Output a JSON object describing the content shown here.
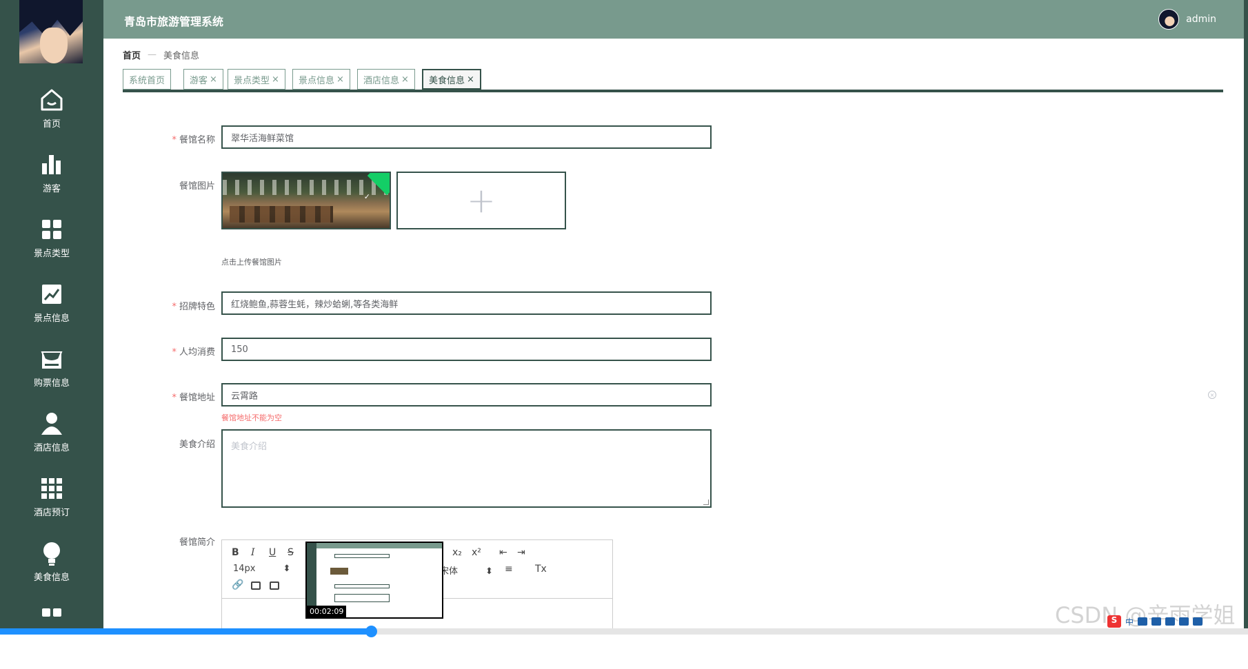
{
  "app": {
    "title": "青岛市旅游管理系统",
    "user": "admin"
  },
  "sidebar": {
    "items": [
      {
        "label": "首页",
        "icon": "home-icon"
      },
      {
        "label": "游客",
        "icon": "bar-chart-icon"
      },
      {
        "label": "景点类型",
        "icon": "grid-icon"
      },
      {
        "label": "景点信息",
        "icon": "line-chart-icon"
      },
      {
        "label": "购票信息",
        "icon": "store-icon"
      },
      {
        "label": "酒店信息",
        "icon": "user-icon"
      },
      {
        "label": "酒店预订",
        "icon": "apps-icon"
      },
      {
        "label": "美食信息",
        "icon": "bulb-icon"
      }
    ]
  },
  "breadcrumb": {
    "home": "首页",
    "sep": "—",
    "current": "美食信息"
  },
  "tabs": [
    {
      "label": "系统首页",
      "closable": false
    },
    {
      "label": "游客",
      "closable": true
    },
    {
      "label": "景点类型",
      "closable": true
    },
    {
      "label": "景点信息",
      "closable": true
    },
    {
      "label": "酒店信息",
      "closable": true
    },
    {
      "label": "美食信息",
      "closable": true,
      "active": true
    }
  ],
  "close_glyph": "×",
  "form": {
    "name": {
      "label": "餐馆名称",
      "value": "翠华活海鲜菜馆",
      "required": true
    },
    "image": {
      "label": "餐馆图片",
      "hint": "点击上传餐馆图片",
      "add_glyph": "+"
    },
    "specialty": {
      "label": "招牌特色",
      "value": "红烧鲍鱼,蒜蓉生蚝，辣炒蛤蜊,等各类海鲜",
      "required": true
    },
    "avg_cost": {
      "label": "人均消费",
      "value": "150",
      "required": true
    },
    "address": {
      "label": "餐馆地址",
      "value": "云霄路",
      "required": true,
      "error": "餐馆地址不能为空"
    },
    "intro": {
      "label": "美食介绍",
      "placeholder": "美食介绍"
    },
    "summary": {
      "label": "餐馆简介"
    }
  },
  "editor": {
    "bold": "B",
    "italic": "I",
    "underline": "U",
    "strike": "S",
    "sub": "x₂",
    "sup": "x²",
    "font_size": "14px",
    "font_family": "宋体",
    "select_arrow": "⬍",
    "clear_format": "Tx"
  },
  "video": {
    "time": "00:02:09",
    "progress": 0.297
  },
  "watermark": "CSDN @辛雨学姐",
  "tray": {
    "logo": "S",
    "lang": "中"
  },
  "colors": {
    "sidebar": "#35524a",
    "header": "#789a8d",
    "accent": "#1e90ff",
    "error": "#f56c6c"
  }
}
